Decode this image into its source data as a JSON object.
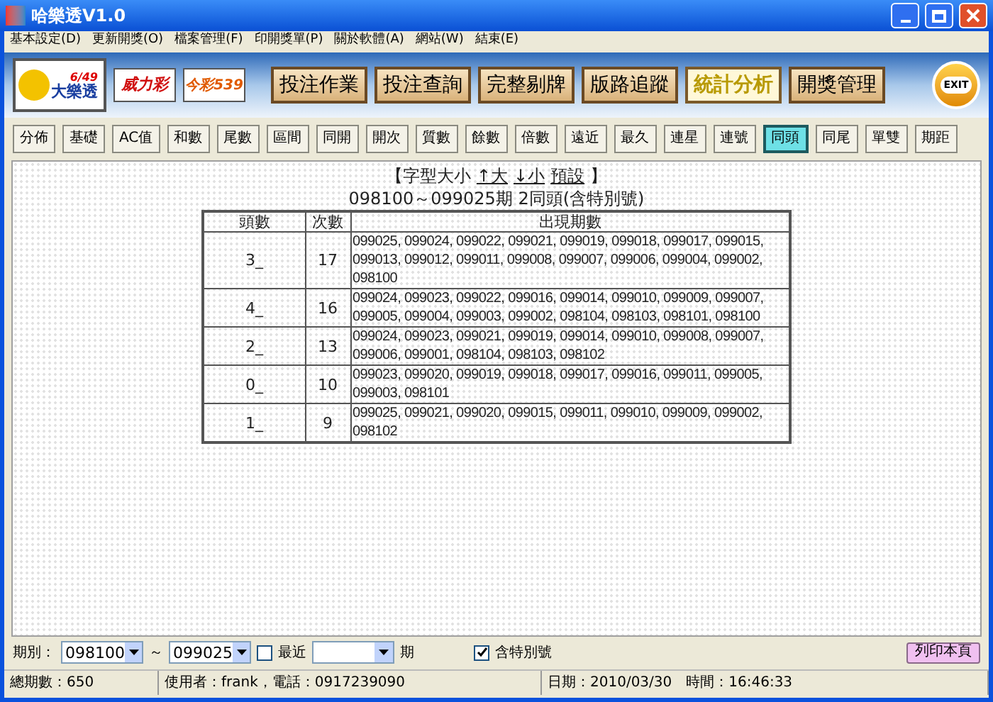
{
  "window": {
    "title": "哈樂透V1.0"
  },
  "menu": [
    "基本設定(D)",
    "更新開獎(O)",
    "檔案管理(F)",
    "印開獎單(P)",
    "關於軟體(A)",
    "網站(W)",
    "結束(E)"
  ],
  "logos": [
    {
      "kind": "big",
      "text": "大樂透",
      "sub": "6/49"
    },
    {
      "kind": "red",
      "text": "威力彩"
    },
    {
      "kind": "multi",
      "text": "今彩539"
    }
  ],
  "main_buttons": [
    {
      "label": "投注作業",
      "selected": false
    },
    {
      "label": "投注查詢",
      "selected": false
    },
    {
      "label": "完整剔牌",
      "selected": false
    },
    {
      "label": "版路追蹤",
      "selected": false
    },
    {
      "label": "統計分析",
      "selected": true
    },
    {
      "label": "開獎管理",
      "selected": false
    }
  ],
  "exit_button": "EXIT",
  "tabs": [
    {
      "label": "分佈",
      "selected": false
    },
    {
      "label": "基礎",
      "selected": false
    },
    {
      "label": "AC值",
      "selected": false
    },
    {
      "label": "和數",
      "selected": false
    },
    {
      "label": "尾數",
      "selected": false
    },
    {
      "label": "區間",
      "selected": false
    },
    {
      "label": "同開",
      "selected": false
    },
    {
      "label": "開次",
      "selected": false
    },
    {
      "label": "質數",
      "selected": false
    },
    {
      "label": "餘數",
      "selected": false
    },
    {
      "label": "倍數",
      "selected": false
    },
    {
      "label": "遠近",
      "selected": false
    },
    {
      "label": "最久",
      "selected": false
    },
    {
      "label": "連星",
      "selected": false
    },
    {
      "label": "連號",
      "selected": false
    },
    {
      "label": "同頭",
      "selected": true
    },
    {
      "label": "同尾",
      "selected": false
    },
    {
      "label": "單雙",
      "selected": false
    },
    {
      "label": "期距",
      "selected": false
    }
  ],
  "font_size_bar": {
    "open": "【字型大小",
    "links": [
      "↑大",
      "↓小",
      "預設"
    ],
    "close": "】"
  },
  "report_title": "098100～099025期 2同頭(含特別號)",
  "table": {
    "columns": [
      "頭數",
      "次數",
      "出現期數"
    ],
    "rows": [
      [
        "3_",
        "17",
        "099025, 099024, 099022, 099021, 099019, 099018, 099017, 099015, 099013, 099012, 099011, 099008, 099007, 099006, 099004, 099002, 098100"
      ],
      [
        "4_",
        "16",
        "099024, 099023, 099022, 099016, 099014, 099010, 099009, 099007, 099005, 099004, 099003, 099002, 098104, 098103, 098101, 098100"
      ],
      [
        "2_",
        "13",
        "099024, 099023, 099021, 099019, 099014, 099010, 099008, 099007, 099006, 099001, 098104, 098103, 098102"
      ],
      [
        "0_",
        "10",
        "099023, 099020, 099019, 099018, 099017, 099016, 099011, 099005, 099003, 098101"
      ],
      [
        "1_",
        "9",
        "099025, 099021, 099020, 099015, 099011, 099010, 099009, 099002, 098102"
      ]
    ]
  },
  "filters": {
    "period_label": "期別：",
    "from": "098100",
    "separator": "～",
    "to": "099025",
    "recent": {
      "label": "最近",
      "checked": false
    },
    "recent_unit": "期",
    "special": {
      "label": "含特別號",
      "checked": true
    },
    "print_button": "列印本頁"
  },
  "status_bar": [
    "總期數：650",
    "使用者：frank，電話：0917239090",
    "日期：2010/03/30　時間：16:46:33"
  ]
}
